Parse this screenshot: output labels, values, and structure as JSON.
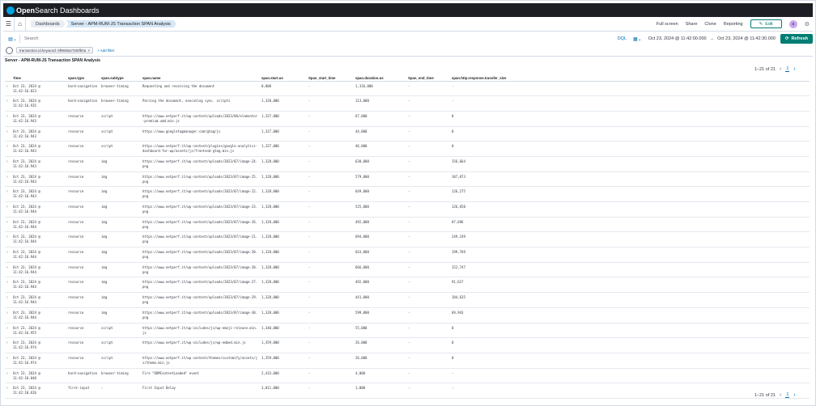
{
  "app": {
    "name": "OpenSearch Dashboards",
    "brand": "Open",
    "brand_rest": "Search Dashboards"
  },
  "breadcrumbs": [
    "Dashboards",
    "Server - APM-RUM-JS Transaction SPAN Analysis"
  ],
  "nav_links": [
    "Full screen",
    "Share",
    "Clone",
    "Reporting"
  ],
  "edit_label": "Edit",
  "avatar_initial": "a",
  "search": {
    "placeholder": "Search",
    "dql": "DQL"
  },
  "date_range": {
    "start": "Oct 23, 2024 @ 11:42:00.000",
    "arrow": "→",
    "end": "Oct 23, 2024 @ 11:42:30.000"
  },
  "refresh_label": "Refresh",
  "filters": [
    {
      "label": "transaction.id.keyword: 6f9836a7330fb0a"
    }
  ],
  "add_filter_label": "+ Add filter",
  "panel": {
    "title": "Server - APM-RUM-JS Transaction SPAN Analysis",
    "pagination": {
      "range": "1–21 of 21",
      "page": "1"
    },
    "columns": [
      "Time",
      "span.type",
      "span.subtype",
      "span.name",
      "span.start.us",
      "Span_start_time",
      "span.duration.us",
      "Span_end_time",
      "span.http.response.transfer_size"
    ],
    "rows": [
      [
        "Oct 23, 2024 @ 11:42:16.823",
        "hard-navigation",
        "browser-timing",
        "Requesting and receiving the document",
        "0,000",
        "-",
        "1,316,000",
        "-",
        "-"
      ],
      [
        "Oct 23, 2024 @ 11:42:16.935",
        "hard-navigation",
        "browser-timing",
        "Parsing the document, executing sync. scripts",
        "1,320,000",
        "-",
        "113,000",
        "-",
        "-"
      ],
      [
        "Oct 23, 2024 @ 11:42:16.943",
        "resource",
        "script",
        "https://www.netperf.it/wp-content/uploads/2023/06/elementor-premium.umd.min.js",
        "1,327,000",
        "-",
        "67,000",
        "-",
        "0"
      ],
      [
        "Oct 23, 2024 @ 11:42:16.943",
        "resource",
        "script",
        "https://www.googletagmanager.com/gtag/js",
        "1,327,000",
        "-",
        "44,000",
        "-",
        "0"
      ],
      [
        "Oct 23, 2024 @ 11:42:16.943",
        "resource",
        "script",
        "https://www.netperf.it/wp-content/plugins/google-analytics-dashboard-for-wp/assets/js/frontend-gtag.min.js",
        "1,327,000",
        "-",
        "46,000",
        "-",
        "0"
      ],
      [
        "Oct 23, 2024 @ 11:42:16.943",
        "resource",
        "img",
        "https://www.netperf.it/wp-content/uploads/2023/07/image-24.png",
        "1,328,000",
        "-",
        "630,000",
        "-",
        "156,664"
      ],
      [
        "Oct 23, 2024 @ 11:42:16.943",
        "resource",
        "img",
        "https://www.netperf.it/wp-content/uploads/2023/07/image-25.png",
        "1,328,000",
        "-",
        "579,000",
        "-",
        "107,873"
      ],
      [
        "Oct 23, 2024 @ 11:42:16.943",
        "resource",
        "img",
        "https://www.netperf.it/wp-content/uploads/2023/07/image-22.png",
        "1,328,000",
        "-",
        "649,000",
        "-",
        "126,275"
      ],
      [
        "Oct 23, 2024 @ 11:42:16.944",
        "resource",
        "img",
        "https://www.netperf.it/wp-content/uploads/2023/07/image-23.png",
        "1,328,000",
        "-",
        "525,000",
        "-",
        "126,650"
      ],
      [
        "Oct 23, 2024 @ 11:42:16.944",
        "resource",
        "img",
        "https://www.netperf.it/wp-content/uploads/2023/07/image-26.png",
        "1,328,000",
        "-",
        "492,000",
        "-",
        "87,696"
      ],
      [
        "Oct 23, 2024 @ 11:42:16.944",
        "resource",
        "img",
        "https://www.netperf.it/wp-content/uploads/2023/07/image-21.png",
        "1,328,000",
        "-",
        "694,000",
        "-",
        "249,249"
      ],
      [
        "Oct 23, 2024 @ 11:42:16.944",
        "resource",
        "img",
        "https://www.netperf.it/wp-content/uploads/2023/07/image-20.png",
        "1,328,000",
        "-",
        "643,000",
        "-",
        "199,769"
      ],
      [
        "Oct 23, 2024 @ 11:42:16.944",
        "resource",
        "img",
        "https://www.netperf.it/wp-content/uploads/2023/07/image-28.png",
        "1,328,000",
        "-",
        "666,000",
        "-",
        "152,747"
      ],
      [
        "Oct 23, 2024 @ 11:42:16.944",
        "resource",
        "img",
        "https://www.netperf.it/wp-content/uploads/2023/07/image-27.png",
        "1,328,000",
        "-",
        "492,000",
        "-",
        "91,617"
      ],
      [
        "Oct 23, 2024 @ 11:42:16.944",
        "resource",
        "img",
        "https://www.netperf.it/wp-content/uploads/2023/07/image-29.png",
        "1,328,000",
        "-",
        "441,000",
        "-",
        "104,635"
      ],
      [
        "Oct 23, 2024 @ 11:42:16.944",
        "resource",
        "img",
        "https://www.netperf.it/wp-content/uploads/2023/07/image-30.png",
        "1,328,000",
        "-",
        "599,000",
        "-",
        "69,943"
      ],
      [
        "Oct 23, 2024 @ 11:42:16.955",
        "resource",
        "script",
        "https://www.netperf.it/wp-includes/js/wp-emoji-release.min.js",
        "1,340,000",
        "-",
        "55,000",
        "-",
        "0"
      ],
      [
        "Oct 23, 2024 @ 11:42:16.974",
        "resource",
        "script",
        "https://www.netperf.it/wp-includes/js/wp-embed.min.js",
        "1,359,000",
        "-",
        "26,000",
        "-",
        "0"
      ],
      [
        "Oct 23, 2024 @ 11:42:16.974",
        "resource",
        "script",
        "https://www.netperf.it/wp-content/themes/customify/assets/js/theme.min.js",
        "1,359,000",
        "-",
        "26,000",
        "-",
        "0"
      ],
      [
        "Oct 23, 2024 @ 11:42:18.048",
        "hard-navigation",
        "browser-timing",
        "Fire \"DOMContentLoaded\" event",
        "2,433,000",
        "-",
        "4,000",
        "-",
        "-"
      ],
      [
        "Oct 23, 2024 @ 11:42:18.626",
        "first-input",
        "-",
        "First Input Delay",
        "3,011,000",
        "-",
        "1,000",
        "-",
        "-"
      ]
    ]
  },
  "colors": {
    "header_bg": "#1d1e24",
    "accent": "#017d73",
    "link": "#006bb4"
  }
}
